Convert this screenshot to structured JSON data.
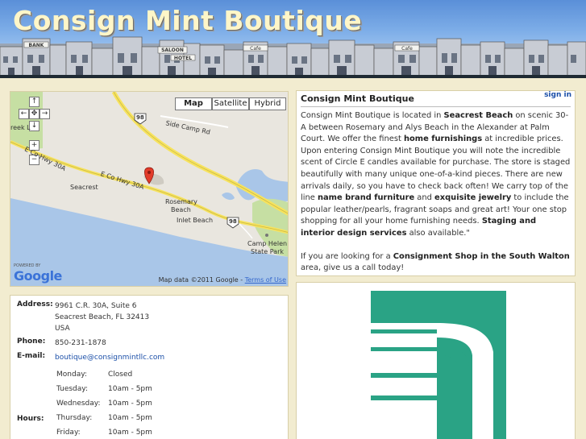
{
  "header": {
    "title": "Consign Mint Boutique",
    "storefront_signs": [
      "BANK",
      "SALOON",
      "HOTEL",
      "Cafe"
    ]
  },
  "map": {
    "type_buttons": [
      "Map",
      "Satellite",
      "Hybrid"
    ],
    "active_type": "Map",
    "labels": {
      "side_camp_rd": "Side Camp Rd",
      "hwy30a_west": "E Co Hwy 30A",
      "hwy30a_east": "E Co Hwy 30A",
      "seacrest": "Seacrest",
      "rosemary": "Rosemary",
      "beach": "Beach",
      "inlet_beach": "Inlet Beach",
      "camp_helen": "Camp Helen",
      "state_park": "State Park",
      "creek": "reek L",
      "shield_north": "98",
      "shield_south": "98"
    },
    "powered_by": "POWERED BY",
    "google": "Google",
    "map_data": "Map data ©2011 Google -",
    "terms": "Terms of Use",
    "colors": {
      "water": "#a9c6e8",
      "land": "#e9e6df",
      "park": "#c6dfa3",
      "road": "#f7e35d"
    }
  },
  "description": {
    "title": "Consign Mint Boutique",
    "sign_in": "sign in",
    "p1_parts": [
      "Consign Mint Boutique is located in ",
      "Seacrest Beach",
      " on scenic 30-A between Rosemary and Alys Beach in the Alexander at Palm Court. We offer the finest ",
      "home furnishings",
      " at incredible prices. Upon entering Consign Mint Boutique you will note the incredible scent of Circle E candles available for purchase. The store is staged beautifully with many unique one-of-a-kind pieces. There are new arrivals daily, so you have to check back often! We carry top of the line ",
      "name brand furniture",
      " and ",
      "exquisite jewelry",
      " to include the popular leather/pearls, fragrant soaps and great art! Your one stop shopping for all your home furnishing needs. ",
      "Staging and interior design services",
      " also available.\""
    ],
    "p2_parts": [
      "If you are looking for a ",
      "Consignment Shop in the South Walton",
      " area, give us a call today!"
    ]
  },
  "info": {
    "address_label": "Address:",
    "address_line1": "9961 C.R. 30A, Suite 6",
    "address_line2": "Seacrest Beach, FL 32413",
    "address_line3": "USA",
    "phone_label": "Phone:",
    "phone": "850-231-1878",
    "email_label": "E-mail:",
    "email": "boutique@consignmintllc.com",
    "hours_label": "Hours:",
    "hours": [
      {
        "day": "Monday:",
        "time": "Closed"
      },
      {
        "day": "Tuesday:",
        "time": "10am - 5pm"
      },
      {
        "day": "Wednesday:",
        "time": "10am - 5pm"
      },
      {
        "day": "Thursday:",
        "time": "10am - 5pm"
      },
      {
        "day": "Friday:",
        "time": "10am - 5pm"
      }
    ]
  },
  "logo": {
    "color": "#2aa385"
  }
}
